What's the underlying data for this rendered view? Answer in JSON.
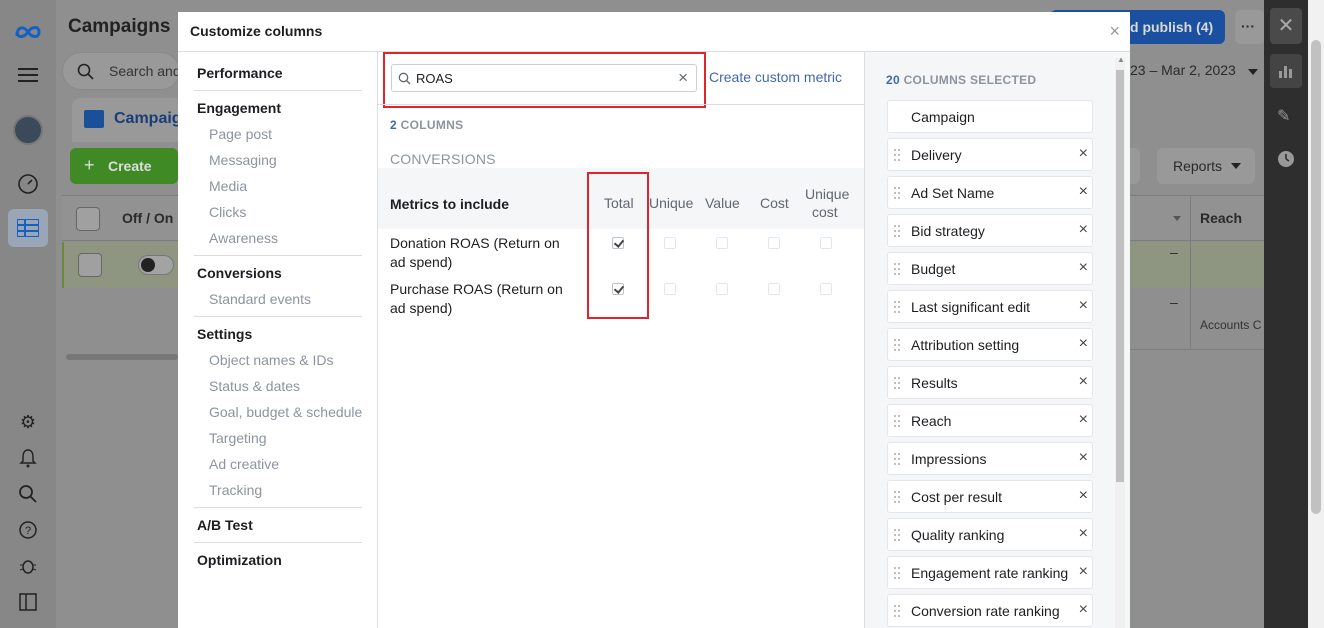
{
  "background": {
    "app_title": "Campaigns",
    "search_placeholder": "Search and",
    "campaign_tab": "Campaig",
    "create_button": "Create",
    "off_on_header": "Off / On",
    "publish_button": "d publish (4)",
    "more_button": "···",
    "date_range": "23 – Mar 2, 2023",
    "reports_button": "Reports",
    "reach_header": "Reach",
    "dash": "–",
    "accounts_text": "Accounts C"
  },
  "modal": {
    "title": "Customize columns",
    "close": "×",
    "nav": [
      {
        "type": "header",
        "label": "Performance"
      },
      {
        "type": "header",
        "label": "Engagement"
      },
      {
        "type": "item",
        "label": "Page post"
      },
      {
        "type": "item",
        "label": "Messaging"
      },
      {
        "type": "item",
        "label": "Media"
      },
      {
        "type": "item",
        "label": "Clicks"
      },
      {
        "type": "item",
        "label": "Awareness"
      },
      {
        "type": "header",
        "label": "Conversions"
      },
      {
        "type": "item",
        "label": "Standard events"
      },
      {
        "type": "header",
        "label": "Settings"
      },
      {
        "type": "item",
        "label": "Object names & IDs"
      },
      {
        "type": "item",
        "label": "Status & dates"
      },
      {
        "type": "item",
        "label": "Goal, budget & schedule"
      },
      {
        "type": "item",
        "label": "Targeting"
      },
      {
        "type": "item",
        "label": "Ad creative"
      },
      {
        "type": "item",
        "label": "Tracking"
      },
      {
        "type": "header",
        "label": "A/B Test"
      },
      {
        "type": "header",
        "label": "Optimization"
      }
    ],
    "search": {
      "value": "ROAS",
      "clear": "×"
    },
    "create_custom_metric": "Create custom metric",
    "columns_count": "2",
    "columns_label": "COLUMNS",
    "section_title": "CONVERSIONS",
    "table": {
      "metrics_header": "Metrics to include",
      "col_total": "Total",
      "col_unique": "Unique",
      "col_value": "Value",
      "col_cost": "Cost",
      "col_unique_cost_1": "Unique",
      "col_unique_cost_2": "cost",
      "rows": [
        {
          "line1": "Donation ROAS (Return on",
          "line2": "ad spend)",
          "total": true
        },
        {
          "line1": "Purchase ROAS (Return on",
          "line2": "ad spend)",
          "total": true
        }
      ]
    },
    "selected": {
      "count": "20",
      "label": "COLUMNS SELECTED",
      "items": [
        "Campaign",
        "Delivery",
        "Ad Set Name",
        "Bid strategy",
        "Budget",
        "Last significant edit",
        "Attribution setting",
        "Results",
        "Reach",
        "Impressions",
        "Cost per result",
        "Quality ranking",
        "Engagement rate ranking",
        "Conversion rate ranking"
      ]
    }
  },
  "colors": {
    "accent": "#4267b2",
    "highlight": "#e0242b",
    "create_green": "#42b72a"
  }
}
